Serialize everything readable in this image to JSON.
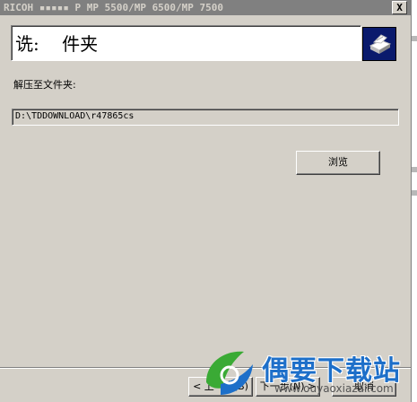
{
  "window": {
    "title": "RICOH ▪▪▪▪▪ P MP 5500/MP 6500/MP 7500",
    "close_label": "X"
  },
  "header": {
    "text": "诜:    件夹",
    "icon": "printer-icon"
  },
  "main": {
    "extract_label": "解压至文件夹:",
    "path_value": "D:\\TDDOWNLOAD\\r47865cs",
    "browse_label": "浏览"
  },
  "footer": {
    "back_label": "< 上一步(B)",
    "next_label": "下一步(N) >",
    "cancel_label": "取消"
  },
  "watermark": {
    "brand": "偶要下载站",
    "url": "www.ouyaoxiazai.com",
    "logo": "leaf-logo-icon"
  },
  "colors": {
    "dialog_bg": "#d4d0c8",
    "titlebar_inactive": "#808080",
    "icon_bg": "#0a1a6c",
    "watermark_blue": "#1d6fc9",
    "watermark_green": "#3aaa35"
  }
}
